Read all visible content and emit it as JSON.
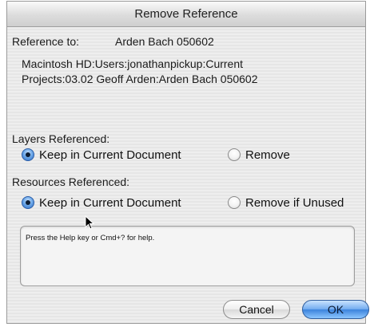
{
  "dialog": {
    "title": "Remove Reference",
    "reference_label": "Reference to:",
    "reference_name": "Arden Bach 050602",
    "path_line1": "Macintosh HD:Users:jonathanpickup:Current",
    "path_line2": "Projects:03.02 Geoff Arden:Arden Bach 050602"
  },
  "layers": {
    "heading": "Layers Referenced:",
    "options": [
      {
        "label": "Keep in Current Document",
        "selected": true
      },
      {
        "label": "Remove",
        "selected": false
      }
    ]
  },
  "resources": {
    "heading": "Resources Referenced:",
    "options": [
      {
        "label": "Keep in Current Document",
        "selected": true
      },
      {
        "label": "Remove if Unused",
        "selected": false
      }
    ]
  },
  "help": {
    "text": "Press the Help key or Cmd+? for help."
  },
  "buttons": {
    "cancel": "Cancel",
    "ok": "OK"
  },
  "colors": {
    "default_button": "#3c83dc",
    "radio_selected": "#2f6fc6"
  },
  "icons": {
    "cursor": "arrow-cursor-icon"
  }
}
